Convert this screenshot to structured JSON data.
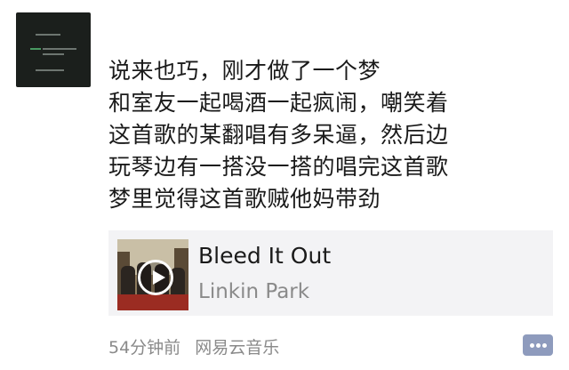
{
  "post": {
    "lines": [
      "说来也巧，刚才做了一个梦",
      "和室友一起喝酒一起疯闹，嘲笑着",
      "这首歌的某翻唱有多呆逼，然后边",
      "玩琴边有一搭没一搭的唱完这首歌",
      "梦里觉得这首歌贼他妈带劲"
    ]
  },
  "music": {
    "title": "Bleed It Out",
    "artist": "Linkin Park",
    "cover_icon": "album-cover",
    "play_icon": "play-icon"
  },
  "meta": {
    "time": "54分钟前",
    "source": "网易云音乐"
  },
  "actions": {
    "comment_icon": "comment-icon"
  }
}
